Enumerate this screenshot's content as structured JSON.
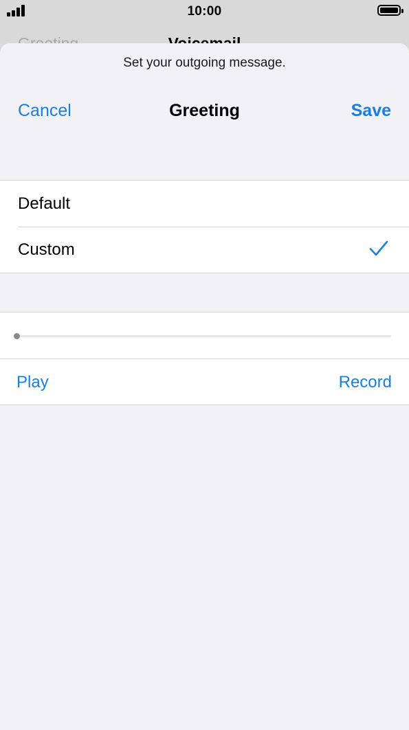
{
  "status_bar": {
    "time": "10:00",
    "signal_icon": "cellular-signal-icon",
    "battery_icon": "battery-icon",
    "battery_level": 1.0
  },
  "background_screen": {
    "back_label": "Greeting",
    "title": "Voicemail"
  },
  "sheet": {
    "prompt": "Set your outgoing message.",
    "nav": {
      "cancel_label": "Cancel",
      "title": "Greeting",
      "save_label": "Save"
    },
    "greeting_options": [
      {
        "label": "Default",
        "selected": false
      },
      {
        "label": "Custom",
        "selected": true
      }
    ],
    "check_icon": "checkmark-icon",
    "playback": {
      "progress": 0.0,
      "play_label": "Play",
      "record_label": "Record"
    }
  },
  "colors": {
    "accent": "#1a7fe3",
    "sheet_background": "#f1f1f6",
    "backdrop": "#d9d9d9",
    "separator": "#d3d3d8"
  }
}
